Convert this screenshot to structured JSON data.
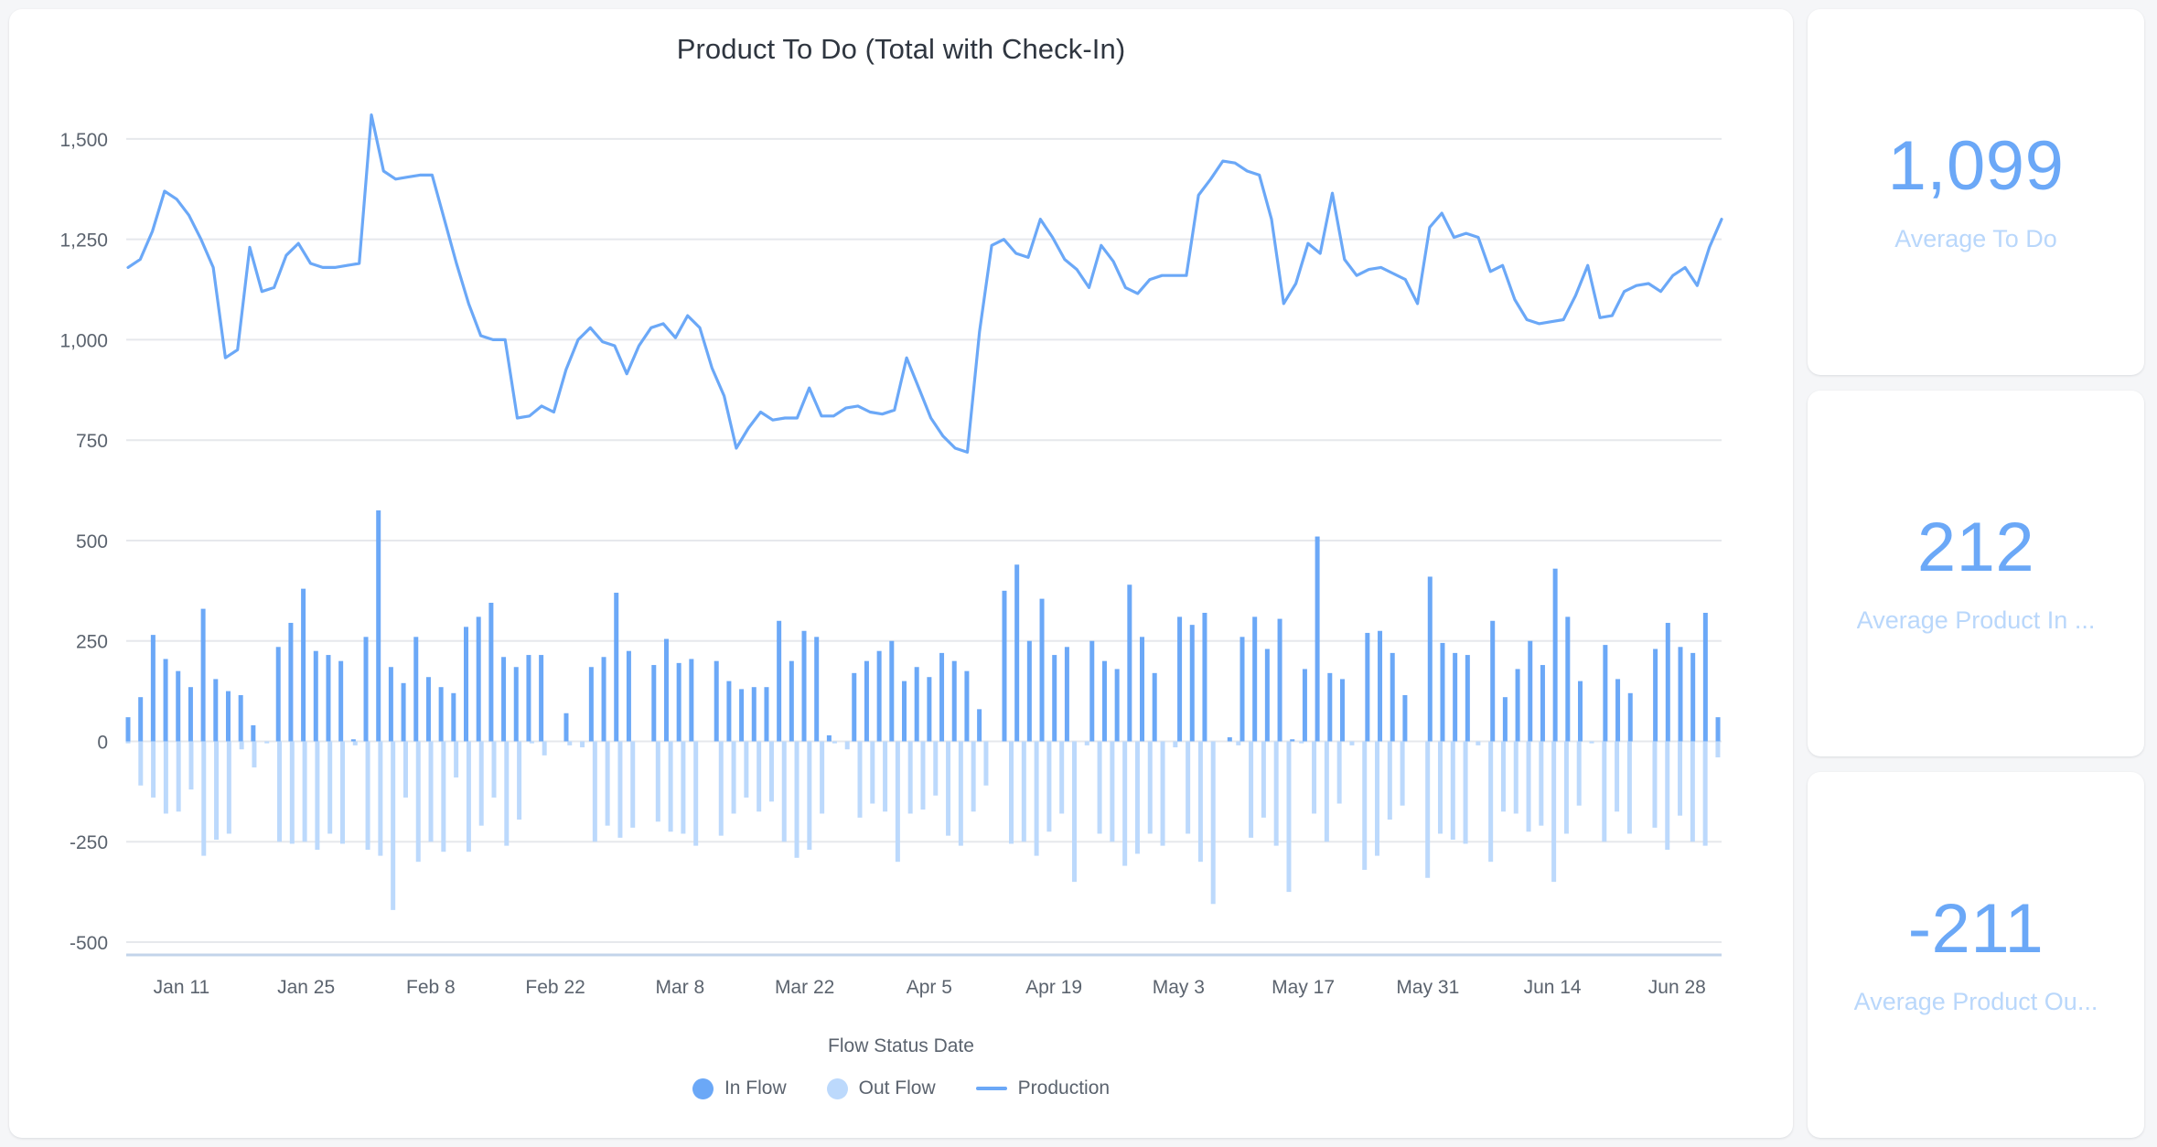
{
  "chart_card": {
    "title": "Product To Do (Total with Check-In)",
    "xaxis_title": "Flow Status Date",
    "legend": [
      {
        "label": "In Flow",
        "marker": "dot",
        "color": "#6ba8f7",
        "name": "legend-in-flow"
      },
      {
        "label": "Out Flow",
        "marker": "dot",
        "color": "#bcd9fc",
        "name": "legend-out-flow"
      },
      {
        "label": "Production",
        "marker": "line",
        "color": "#6ba8f7",
        "name": "legend-production"
      }
    ]
  },
  "kpis": [
    {
      "value": "1,099",
      "label": "Average To Do",
      "name": "kpi-average-to-do"
    },
    {
      "value": "212",
      "label": "Average Product In ...",
      "name": "kpi-average-product-in"
    },
    {
      "value": "-211",
      "label": "Average Product Ou...",
      "name": "kpi-average-product-out"
    }
  ],
  "colors": {
    "in_flow": "#6ba8f7",
    "out_flow": "#bcd9fc",
    "production_line": "#6ba8f7",
    "kpi_value": "#6ba8f7",
    "kpi_label": "#b9d7fb",
    "gridline": "#e6e8ec",
    "axis_line": "#c3d4ea",
    "card_bg": "#ffffff",
    "page_bg": "#f5f6f8",
    "title_text": "#2f3640",
    "tick_text": "#5b636e"
  },
  "chart_data": {
    "type": "bar",
    "title": "Product To Do (Total with Check-In)",
    "xlabel": "Flow Status Date",
    "ylabel": "",
    "ylim": [
      -500,
      1600
    ],
    "grid": true,
    "legend_position": "bottom",
    "y_ticks": [
      1500,
      1250,
      1000,
      750,
      500,
      250,
      0,
      -250,
      -500
    ],
    "y_tick_labels": [
      "1,500",
      "1,250",
      "1,000",
      "750",
      "500",
      "250",
      "0",
      "-250",
      "-500"
    ],
    "x_tick_labels": [
      "Jan 11",
      "Jan 25",
      "Feb 8",
      "Feb 22",
      "Mar 8",
      "Mar 22",
      "Apr 5",
      "Apr 19",
      "May 3",
      "May 17",
      "May 31",
      "Jun 14",
      "Jun 28"
    ],
    "x_tick_indices": [
      6,
      20,
      34,
      48,
      62,
      76,
      90,
      104,
      118,
      132,
      146,
      160,
      174
    ],
    "n_points": 180,
    "series": [
      {
        "name": "Production",
        "type": "line",
        "color": "#6ba8f7",
        "values": [
          1180,
          1200,
          1270,
          1370,
          1350,
          1310,
          1250,
          1180,
          955,
          975,
          1230,
          1120,
          1130,
          1210,
          1240,
          1190,
          1180,
          1180,
          1185,
          1190,
          1560,
          1420,
          1400,
          1405,
          1410,
          1410,
          1300,
          1190,
          1090,
          1010,
          1000,
          1000,
          805,
          810,
          835,
          820,
          925,
          1000,
          1030,
          995,
          985,
          915,
          985,
          1030,
          1040,
          1005,
          1060,
          1030,
          930,
          860,
          730,
          780,
          820,
          800,
          805,
          805,
          880,
          810,
          810,
          830,
          835,
          820,
          815,
          825,
          955,
          880,
          805,
          760,
          730,
          720,
          1020,
          1235,
          1250,
          1215,
          1205,
          1300,
          1255,
          1200,
          1175,
          1130,
          1235,
          1195,
          1130,
          1115,
          1150,
          1160,
          1160,
          1160,
          1360,
          1400,
          1445,
          1440,
          1420,
          1410,
          1300,
          1090,
          1140,
          1240,
          1215,
          1365,
          1200,
          1160,
          1175,
          1180,
          1165,
          1150,
          1090,
          1280,
          1315,
          1255,
          1265,
          1255,
          1170,
          1185,
          1100,
          1050,
          1040,
          1045,
          1050,
          1110,
          1185,
          1055,
          1060,
          1120,
          1135,
          1140,
          1120,
          1160,
          1180,
          1135,
          1230,
          1300
        ]
      },
      {
        "name": "In Flow",
        "type": "bar",
        "color": "#6ba8f7",
        "values": [
          60,
          110,
          265,
          205,
          175,
          135,
          330,
          155,
          125,
          115,
          40,
          0,
          235,
          295,
          380,
          225,
          215,
          200,
          5,
          260,
          575,
          185,
          145,
          260,
          160,
          135,
          120,
          285,
          310,
          345,
          210,
          185,
          215,
          215,
          0,
          70,
          0,
          185,
          210,
          370,
          225,
          0,
          190,
          255,
          195,
          205,
          0,
          200,
          150,
          130,
          135,
          135,
          300,
          200,
          275,
          260,
          15,
          0,
          170,
          200,
          225,
          250,
          150,
          185,
          160,
          220,
          200,
          175,
          80,
          0,
          375,
          440,
          250,
          355,
          215,
          235,
          0,
          250,
          200,
          180,
          390,
          260,
          170,
          0,
          310,
          290,
          320,
          0,
          10,
          260,
          310,
          230,
          305,
          5,
          180,
          510,
          170,
          155,
          0,
          270,
          275,
          220,
          115,
          0,
          410,
          245,
          220,
          215,
          0,
          300,
          110,
          180,
          250,
          190,
          430,
          310,
          150,
          0,
          240,
          155,
          120,
          0,
          230,
          295,
          235,
          220,
          320,
          60
        ]
      },
      {
        "name": "Out Flow",
        "type": "bar",
        "color": "#bcd9fc",
        "values": [
          -5,
          -110,
          -140,
          -180,
          -175,
          -120,
          -285,
          -245,
          -230,
          -20,
          -65,
          -5,
          -250,
          -255,
          -250,
          -270,
          -230,
          -255,
          -10,
          -270,
          -285,
          -420,
          -140,
          -300,
          -250,
          -275,
          -90,
          -275,
          -210,
          -140,
          -260,
          -195,
          -5,
          -35,
          0,
          -10,
          -15,
          -250,
          -210,
          -240,
          -215,
          0,
          -200,
          -225,
          -230,
          -260,
          0,
          -235,
          -180,
          -140,
          -175,
          -150,
          -250,
          -290,
          -270,
          -180,
          -5,
          -20,
          -190,
          -155,
          -175,
          -300,
          -180,
          -170,
          -135,
          -235,
          -260,
          -175,
          -110,
          0,
          -255,
          -250,
          -285,
          -225,
          -180,
          -350,
          -10,
          -230,
          -250,
          -310,
          -280,
          -230,
          -260,
          -15,
          -230,
          -300,
          -405,
          0,
          -10,
          -240,
          -190,
          -260,
          -375,
          -5,
          -180,
          -250,
          -155,
          -10,
          -320,
          -285,
          -195,
          -160,
          0,
          -340,
          -230,
          -245,
          -255,
          -10,
          -300,
          -175,
          -180,
          -225,
          -210,
          -350,
          -230,
          -160,
          -5,
          -250,
          -175,
          -230,
          0,
          -215,
          -270,
          -185,
          -250,
          -260,
          -40
        ]
      }
    ]
  }
}
